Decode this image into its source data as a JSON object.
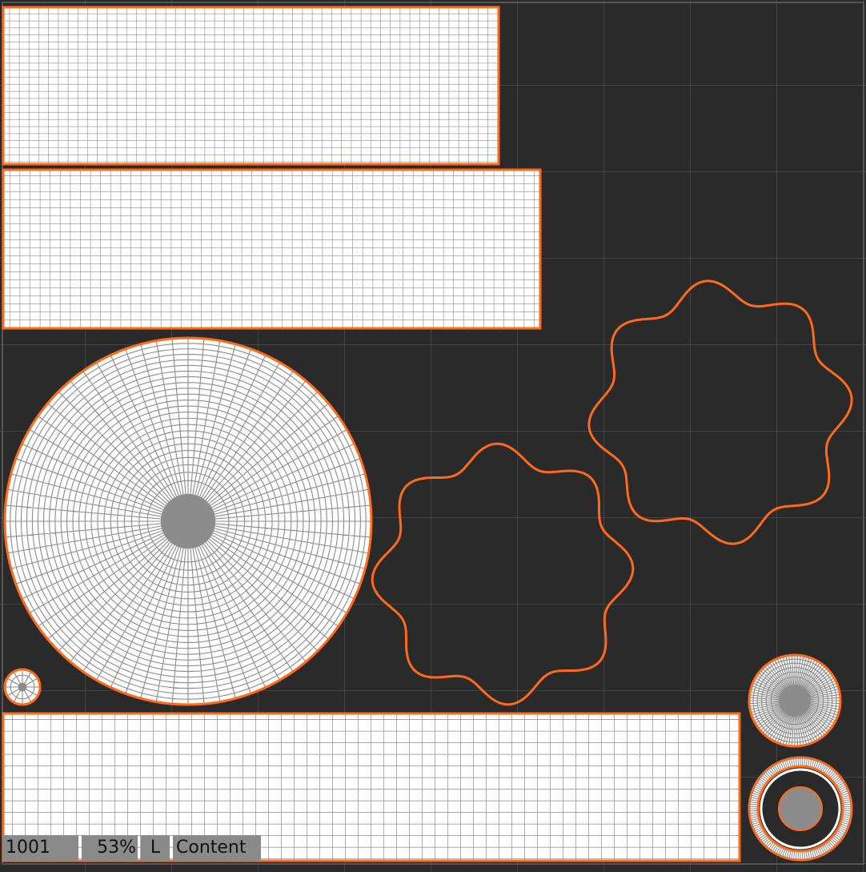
{
  "status": {
    "tile": "1001",
    "zoom": "53%",
    "mode": "L",
    "channel": "Content"
  },
  "colors": {
    "background": "#2a2a2a",
    "grid_line": "#4a4a4a",
    "uv_border": "#ff6a1a",
    "uv_fill": "#ffffff",
    "uv_wire": "#888888",
    "status_bg": "#8a8a8a"
  },
  "icons": {
    "uv-shell-icon": "mesh"
  }
}
